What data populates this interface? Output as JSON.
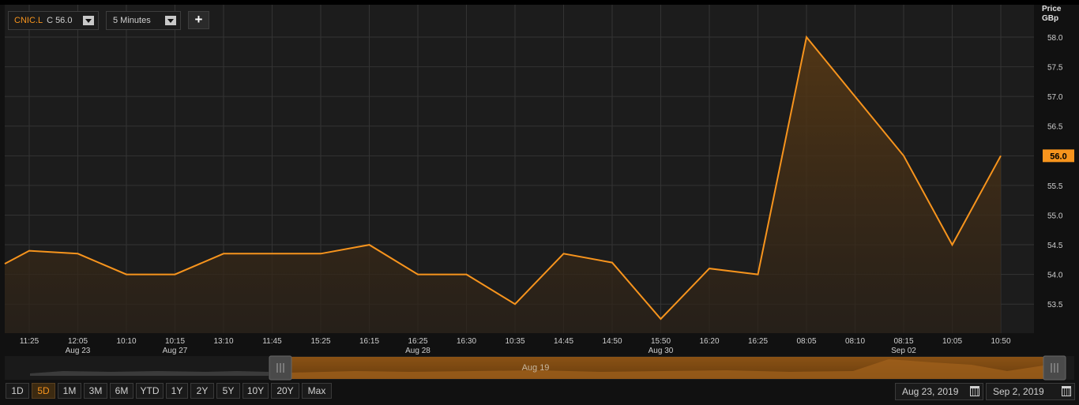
{
  "toolbar": {
    "symbol": "CNIC.L",
    "last_price_label": "C 56.0",
    "interval": "5 Minutes",
    "add_label": "+"
  },
  "axis_title": {
    "line1": "Price",
    "line2": "GBp"
  },
  "navigator": {
    "label": "Aug 19"
  },
  "ranges": [
    "1D",
    "5D",
    "1M",
    "3M",
    "6M",
    "YTD",
    "1Y",
    "2Y",
    "5Y",
    "10Y",
    "20Y",
    "Max"
  ],
  "active_range": "5D",
  "date_range": {
    "start": "Aug 23, 2019",
    "end": "Sep 2, 2019"
  },
  "colors": {
    "line": "#f7941d",
    "background": "#1c1c1c",
    "grid": "#333333",
    "badge": "#f7941d"
  },
  "chart_data": {
    "type": "area",
    "x": [
      "11:25",
      "12:05",
      "10:10",
      "10:15",
      "13:10",
      "11:45",
      "15:25",
      "16:15",
      "16:25",
      "16:30",
      "10:35",
      "14:45",
      "14:50",
      "15:50",
      "16:20",
      "16:25",
      "08:05",
      "08:10",
      "08:15",
      "10:05",
      "10:50"
    ],
    "x_dates": [
      "",
      "Aug 23",
      "",
      "Aug 27",
      "",
      "",
      "",
      "",
      "Aug 28",
      "",
      "",
      "",
      "",
      "Aug 30",
      "",
      "",
      "",
      "",
      "Sep 02",
      "",
      ""
    ],
    "series": [
      {
        "values": [
          54.18,
          54.4,
          54.35,
          54.0,
          54.0,
          54.35,
          54.35,
          54.35,
          54.5,
          54.0,
          54.0,
          53.5,
          54.35,
          54.2,
          53.25,
          54.1,
          54.0,
          58.0,
          57.0,
          56.0,
          54.5,
          56.0
        ]
      }
    ],
    "x_points": [
      0,
      0.5,
      1.5,
      2.5,
      3.5,
      4.5,
      5.5,
      6.5,
      7.5,
      8.5,
      9.5,
      10.5,
      11.5,
      12.5,
      13.5,
      14.5,
      15.5,
      16.5,
      17.5,
      18.5,
      19.5,
      20.5
    ],
    "yticks": [
      53.5,
      54.0,
      54.5,
      55.0,
      55.5,
      56.0,
      56.5,
      57.0,
      57.5,
      58.0
    ],
    "ylim": [
      53.0,
      58.5
    ],
    "last_value": "56.0",
    "ylabel": "Price GBp",
    "grid": true
  }
}
